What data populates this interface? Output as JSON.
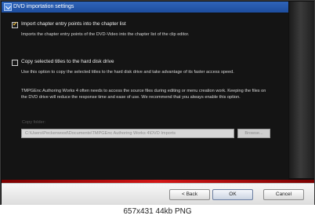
{
  "window": {
    "title": "DVD importation settings"
  },
  "options": [
    {
      "label": "Import chapter entry points into the chapter list",
      "checked": true,
      "description": "Imports the chapter entry points of the DVD-Video into the chapter list of the clip editor."
    },
    {
      "label": "Copy selected titles to the hard disk drive",
      "checked": false,
      "description": "Use this option to copy the selected titles to the hard disk drive and take advantage of its faster access speed.",
      "note": "TMPGEnc Authoring Works 4 often needs to access the source files during editing or menu creation work. Keeping the files on the DVD drive will reduce the response time and ease of use. We recommend that you always enable this option."
    }
  ],
  "copy_folder": {
    "label": "Copy folder:",
    "value": "C:\\Users\\Peckerwood\\Documents\\TMPGEnc Authoring Works 4\\DVD Imports",
    "browse_label": "Browse..."
  },
  "buttons": {
    "back": "< Back",
    "ok": "OK",
    "cancel": "Cancel"
  },
  "caption": "657x431 44kb PNG"
}
